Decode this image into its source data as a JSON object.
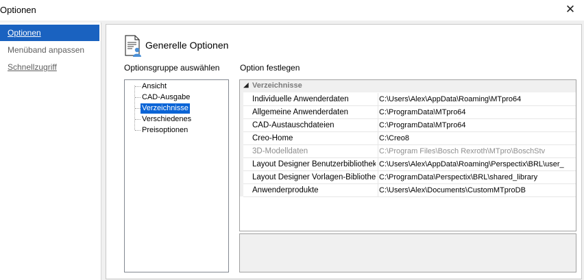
{
  "window": {
    "title": "Optionen",
    "close_glyph": "✕"
  },
  "nav": {
    "items": [
      {
        "label": "Optionen",
        "selected": true
      },
      {
        "label": "Menüband anpassen",
        "selected": false
      },
      {
        "label": "Schnellzugriff",
        "selected": false
      }
    ]
  },
  "header": {
    "title": "Generelle Optionen",
    "icon": "options-document-icon"
  },
  "groups": {
    "label": "Optionsgruppe auswählen",
    "items": [
      "Ansicht",
      "CAD-Ausgabe",
      "Verzeichnisse",
      "Verschiedenes",
      "Preisoptionen"
    ],
    "selected": "Verzeichnisse"
  },
  "options": {
    "label": "Option festlegen",
    "category": "Verzeichnisse",
    "rows": [
      {
        "name": "Individuelle Anwenderdaten",
        "value": "C:\\Users\\Alex\\AppData\\Roaming\\MTpro64",
        "disabled": false
      },
      {
        "name": "Allgemeine Anwenderdaten",
        "value": "C:\\ProgramData\\MTpro64",
        "disabled": false
      },
      {
        "name": "CAD-Austauschdateien",
        "value": "C:\\ProgramData\\MTpro64",
        "disabled": false
      },
      {
        "name": "Creo-Home",
        "value": "C:\\Creo8",
        "disabled": false
      },
      {
        "name": "3D-Modelldaten",
        "value": "C:\\Program Files\\Bosch Rexroth\\MTpro\\BoschStv",
        "disabled": true
      },
      {
        "name": "Layout Designer Benutzerbibliothek",
        "value": "C:\\Users\\Alex\\AppData\\Roaming\\Perspectix\\BRL\\user_",
        "disabled": false
      },
      {
        "name": "Layout Designer Vorlagen-Bibliothek",
        "value": "C:\\ProgramData\\Perspectix\\BRL\\shared_library",
        "disabled": false
      },
      {
        "name": "Anwenderprodukte",
        "value": "C:\\Users\\Alex\\Documents\\CustomMTproDB",
        "disabled": false
      }
    ]
  },
  "description": ""
}
